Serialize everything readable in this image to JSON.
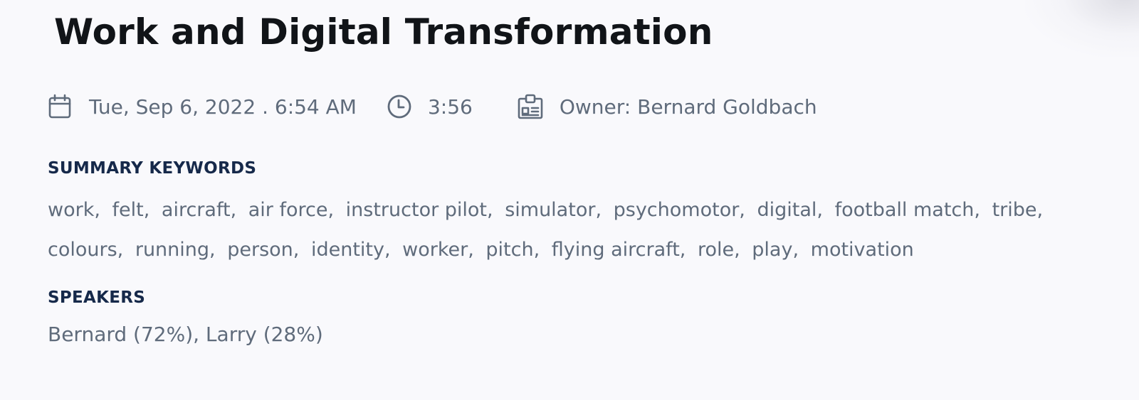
{
  "title": "Work and Digital Transformation",
  "meta": {
    "date": "Tue, Sep 6, 2022 . 6:54 AM",
    "duration": "3:56",
    "owner": "Owner: Bernard Goldbach",
    "icons": {
      "date": "calendar-icon",
      "duration": "clock-icon",
      "owner": "id-badge-icon"
    }
  },
  "summary_keywords": {
    "label": "SUMMARY KEYWORDS",
    "items": [
      "work,",
      "felt,",
      "aircraft,",
      "air force,",
      "instructor pilot,",
      "simulator,",
      "psychomotor,",
      "digital,",
      "football match,",
      "tribe,",
      "colours,",
      "running,",
      "person,",
      "identity,",
      "worker,",
      "pitch,",
      "flying aircraft,",
      "role,",
      "play,",
      "motivation"
    ]
  },
  "speakers": {
    "label": "SPEAKERS",
    "text": "Bernard (72%), Larry (28%)"
  },
  "colors": {
    "background": "#f9f9fc",
    "title": "#111418",
    "meta_text": "#5f6b7b",
    "section_label": "#16294a"
  }
}
